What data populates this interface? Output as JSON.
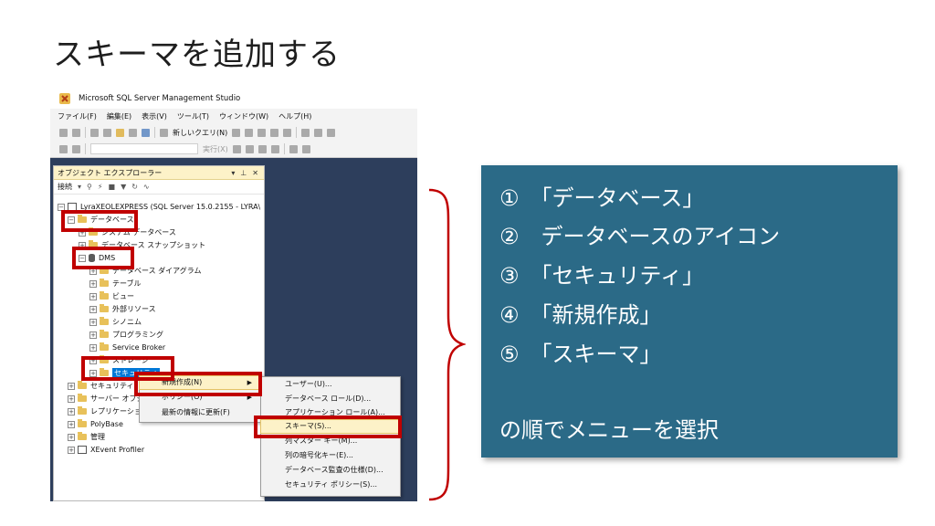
{
  "slide": {
    "title": "スキーマを追加する"
  },
  "ssms": {
    "window_title": "Microsoft SQL Server Management Studio",
    "menu": [
      "ファイル(F)",
      "編集(E)",
      "表示(V)",
      "ツール(T)",
      "ウィンドウ(W)",
      "ヘルプ(H)"
    ],
    "toolbar": {
      "new_query": "新しいクエリ(N)",
      "execute": "実行(X)"
    },
    "object_explorer": {
      "title": "オブジェクト エクスプローラー",
      "connect": "接続",
      "tree": {
        "server": "LyraXEOLEXPRESS (SQL Server 15.0.2155 - LYRA\\",
        "databases": "データベース",
        "system_databases": "システム データベース",
        "snapshots": "データベース スナップショット",
        "dms": "DMS",
        "diagrams": "データベース ダイアグラム",
        "tables": "テーブル",
        "views": "ビュー",
        "external_resources": "外部リソース",
        "synonyms": "シノニム",
        "programming": "プログラミング",
        "service_broker": "Service Broker",
        "storage": "ストレージ",
        "security_db": "セキュリティ",
        "security_server": "セキュリティ",
        "server_objects": "サーバー オブジェクト",
        "replication": "レプリケーション",
        "polybase": "PolyBase",
        "management": "管理",
        "xevent": "XEvent Profiler"
      }
    },
    "context_menu": {
      "new": "新規作成(N)",
      "policies": "ポリシー(O)",
      "refresh": "最新の情報に更新(F)"
    },
    "submenu": {
      "user": "ユーザー(U)...",
      "db_role": "データベース ロール(D)...",
      "app_role": "アプリケーション ロール(A)...",
      "schema": "スキーマ(S)...",
      "cmk": "列マスター キー(M)...",
      "cek": "列の暗号化キー(E)...",
      "audit": "データベース監査の仕様(D)...",
      "sec_policy": "セキュリティ ポリシー(S)..."
    }
  },
  "instructions": {
    "steps": [
      "①　「データベース」",
      "②　データベースのアイコン",
      "③　「セキュリティ」",
      "④　「新規作成」",
      "⑤　「スキーマ」"
    ],
    "footer": "の順でメニューを選択"
  },
  "colors": {
    "highlight_red": "#c00000",
    "info_box": "#2b6a87",
    "selection": "#0078d7"
  }
}
